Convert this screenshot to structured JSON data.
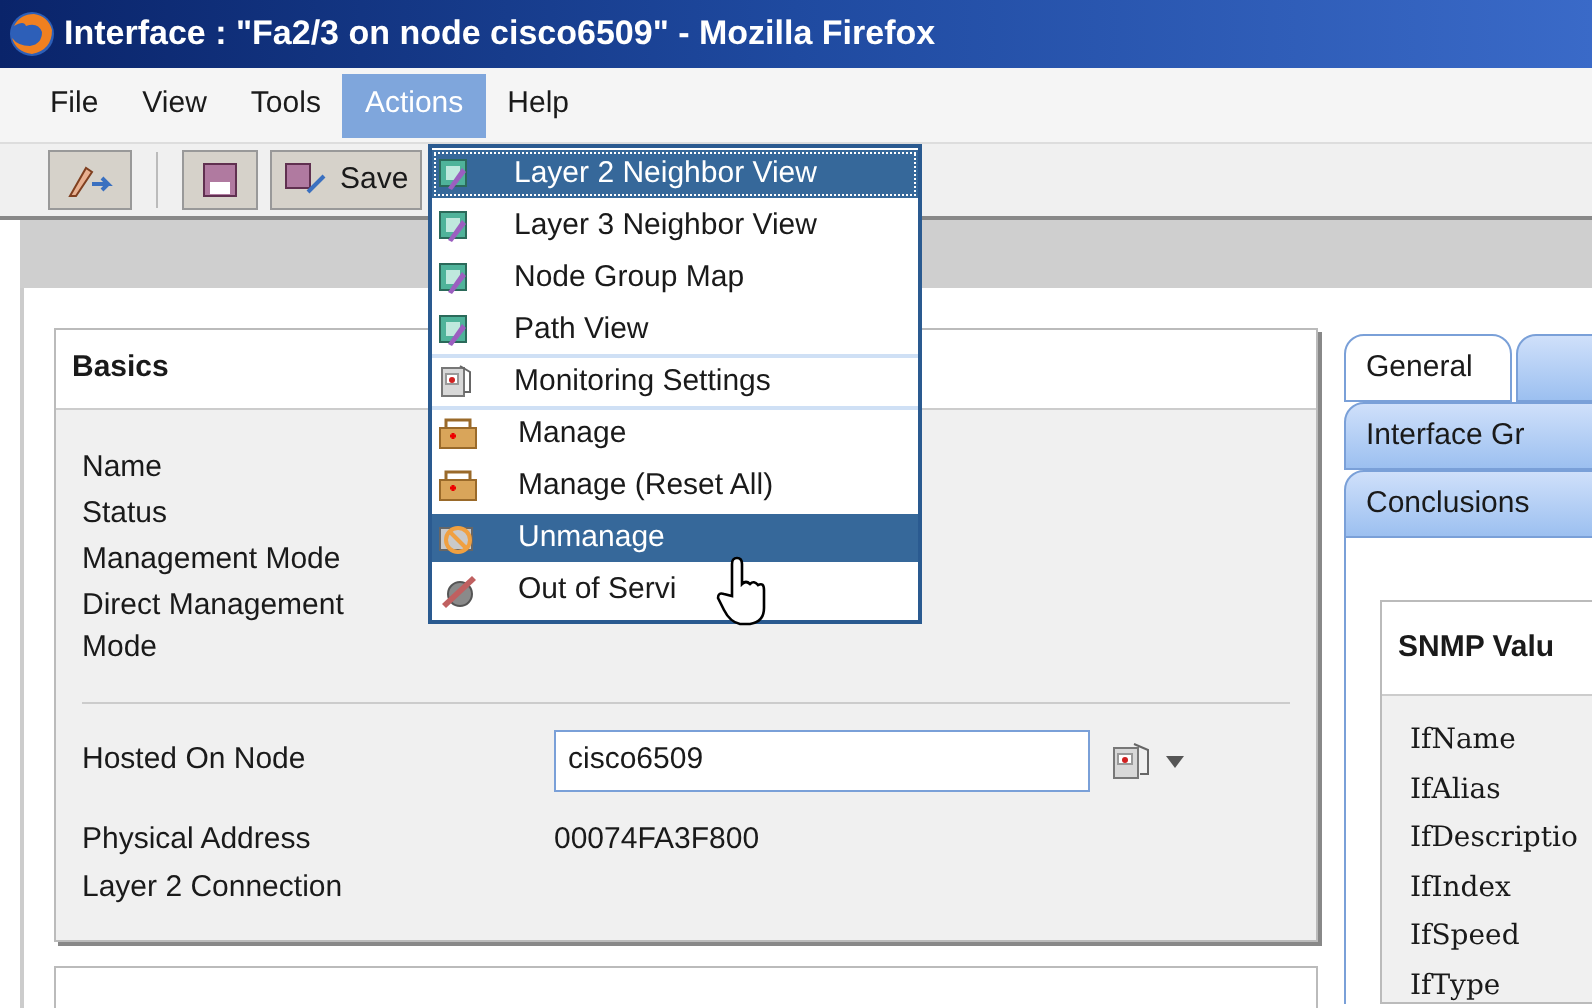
{
  "window": {
    "title": "Interface : \"Fa2/3 on node cisco6509\" - Mozilla Firefox"
  },
  "menu_bar": [
    {
      "label": "File",
      "selected": false
    },
    {
      "label": "View",
      "selected": false
    },
    {
      "label": "Tools",
      "selected": false
    },
    {
      "label": "Actions",
      "selected": true
    },
    {
      "label": "Help",
      "selected": false
    }
  ],
  "toolbar": {
    "save_label": "Save"
  },
  "actions_menu": [
    {
      "label": "Layer 2 Neighbor View",
      "highlighted": true,
      "focused": true,
      "kind": "map",
      "separator_after": false
    },
    {
      "label": "Layer 3 Neighbor View",
      "highlighted": false,
      "focused": false,
      "kind": "map",
      "separator_after": false
    },
    {
      "label": "Node Group Map",
      "highlighted": false,
      "focused": false,
      "kind": "map",
      "separator_after": false
    },
    {
      "label": "Path View",
      "highlighted": false,
      "focused": false,
      "kind": "map",
      "separator_after": true
    },
    {
      "label": "Monitoring Settings",
      "highlighted": false,
      "focused": false,
      "kind": "settings",
      "separator_after": true
    },
    {
      "label": "Manage",
      "highlighted": false,
      "focused": false,
      "kind": "toolbox",
      "separator_after": false
    },
    {
      "label": "Manage (Reset All)",
      "highlighted": false,
      "focused": false,
      "kind": "toolbox",
      "separator_after": false
    },
    {
      "label": "Unmanage",
      "highlighted": true,
      "focused": false,
      "kind": "unmanage",
      "separator_after": false
    },
    {
      "label": "Out of Servi",
      "highlighted": false,
      "focused": false,
      "kind": "service",
      "separator_after": false
    }
  ],
  "basics": {
    "title": "Basics",
    "rows": [
      {
        "label": "Name"
      },
      {
        "label": "Status"
      },
      {
        "label": "Management Mode"
      },
      {
        "label": "Direct Management Mode"
      }
    ],
    "hosted_on_node": {
      "label": "Hosted On Node",
      "value": "cisco6509"
    },
    "detail_rows": [
      {
        "label": "Physical Address",
        "value": "00074FA3F800"
      },
      {
        "label": "Layer 2 Connection"
      }
    ]
  },
  "tab_rows": [
    [
      {
        "label": "General",
        "selected": true
      },
      {
        "selected": false
      }
    ],
    [
      {
        "label": "Interface Gr",
        "selected": false
      }
    ],
    [
      {
        "label": "Conclusions",
        "selected": false
      }
    ]
  ],
  "snmp": {
    "title": "SNMP Valu",
    "fields": [
      "IfName",
      "IfAlias",
      "IfDescriptio",
      "IfIndex",
      "IfSpeed",
      "IfType"
    ]
  }
}
